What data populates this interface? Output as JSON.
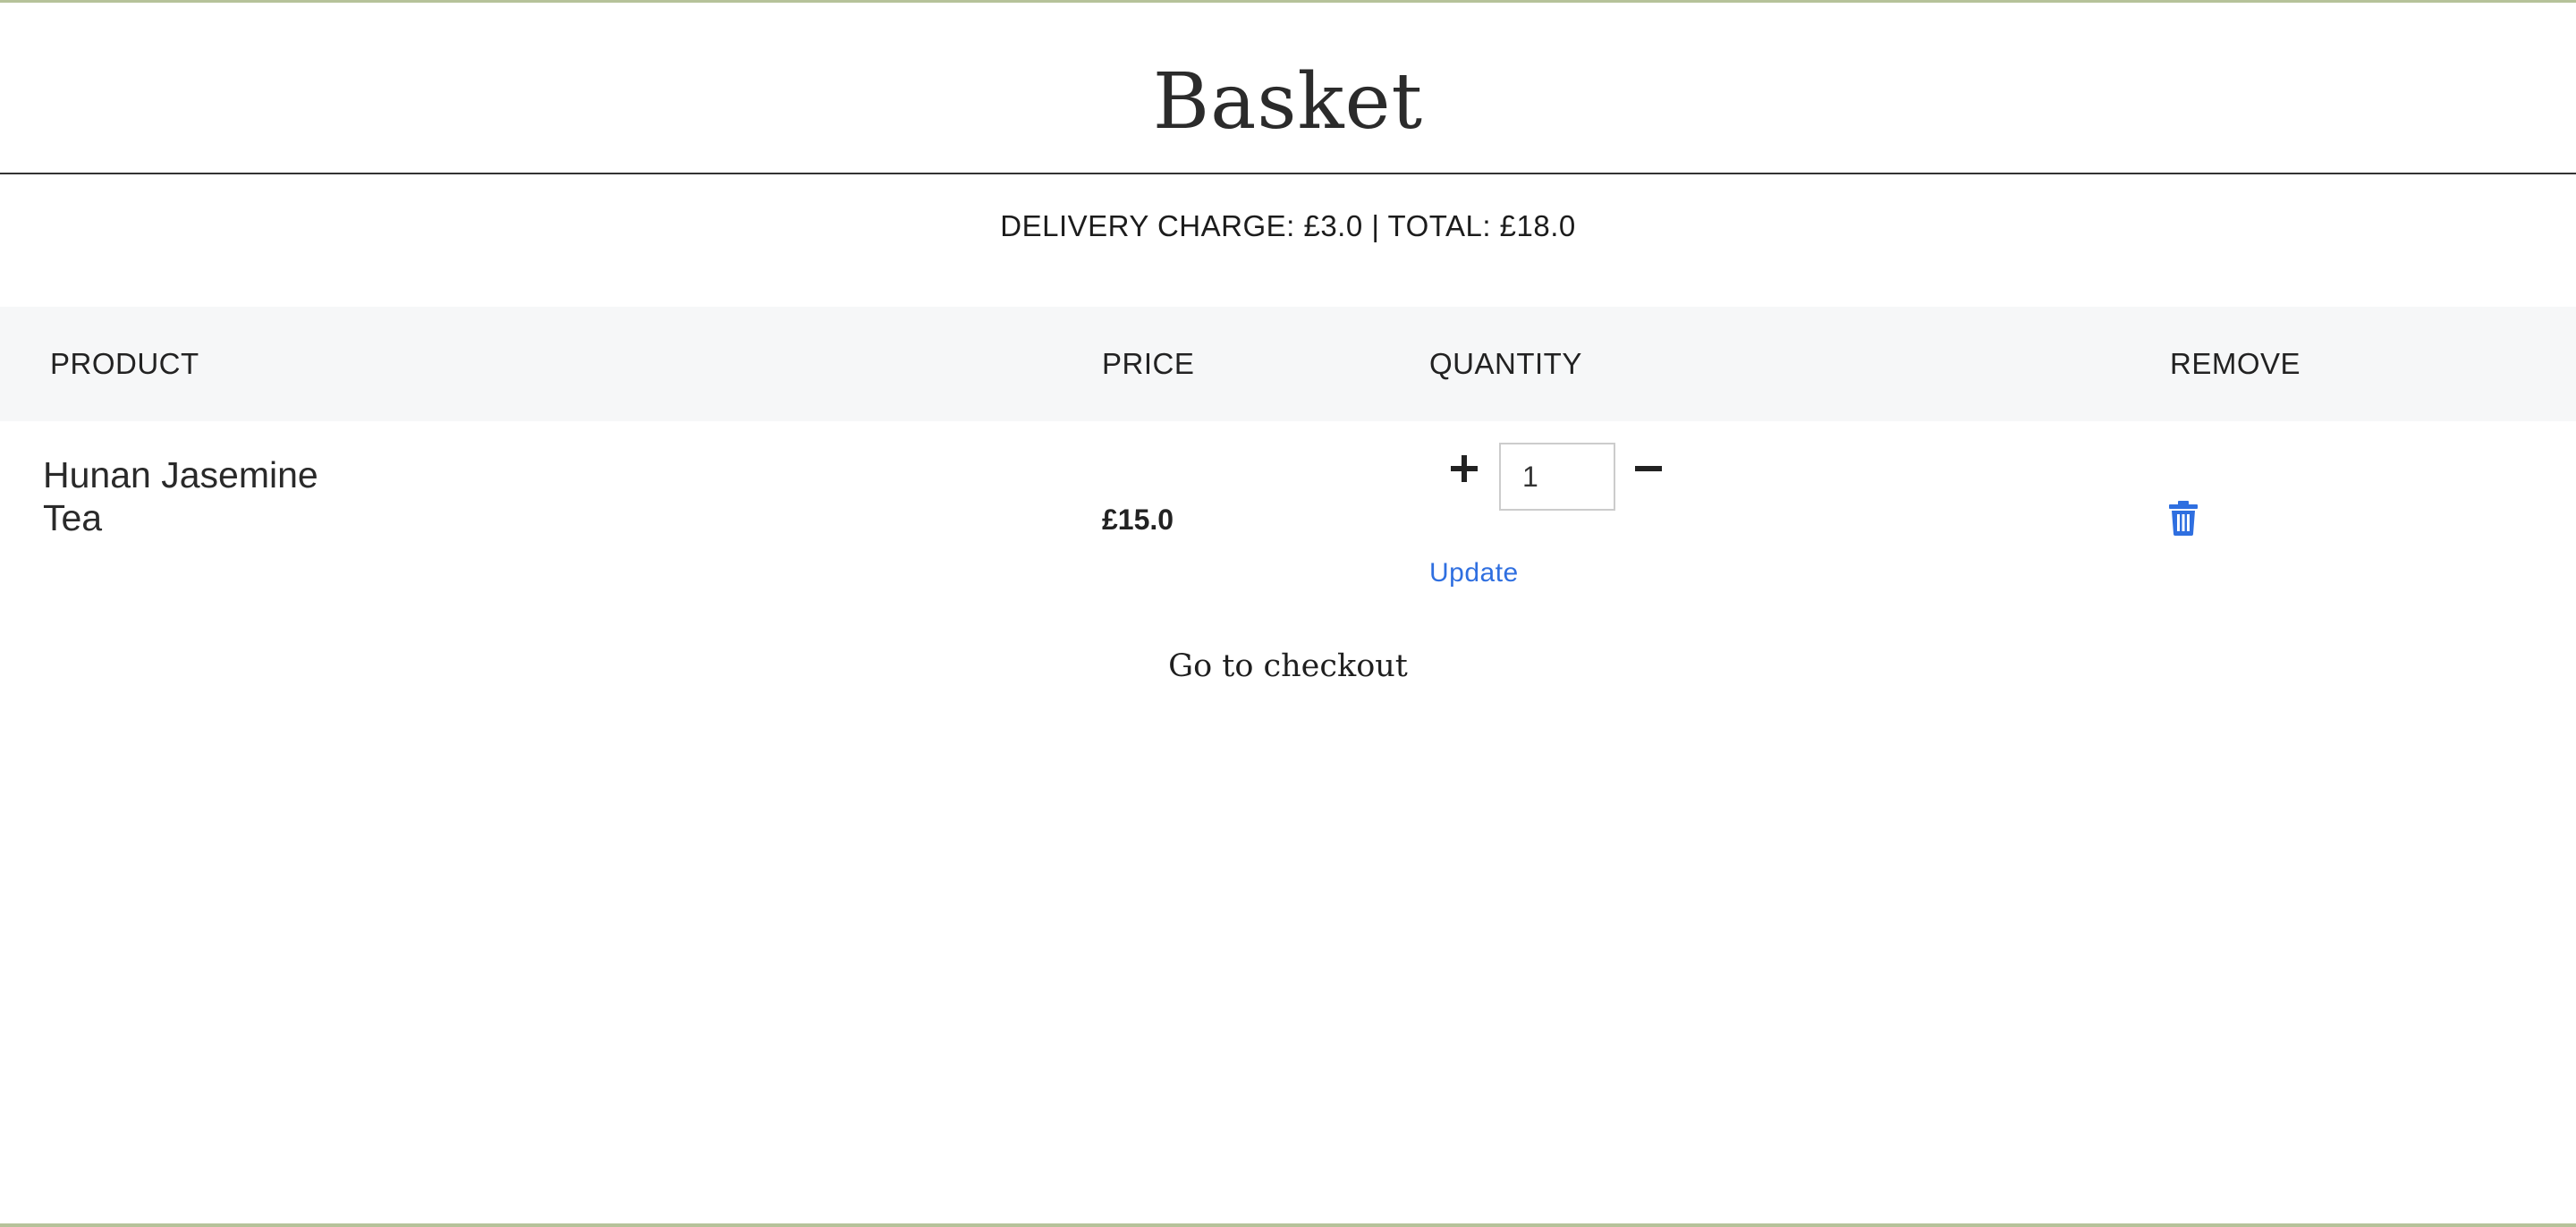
{
  "page": {
    "title": "Basket"
  },
  "summary": {
    "text": "DELIVERY CHARGE: £3.0 | TOTAL: £18.0"
  },
  "table": {
    "headers": {
      "product": "PRODUCT",
      "price": "PRICE",
      "quantity": "QUANTITY",
      "remove": "REMOVE"
    },
    "rows": [
      {
        "product_line1": "Hunan Jasemine",
        "product_line2": "Tea",
        "price": "£15.0",
        "quantity": "1",
        "update_label": "Update",
        "increment_icon": "plus-icon",
        "decrement_icon": "minus-icon",
        "remove_icon": "trash-icon"
      }
    ]
  },
  "checkout": {
    "label": "Go to checkout"
  },
  "colors": {
    "accent_blue": "#2f6fe0",
    "border_green": "#b6c29a",
    "header_bg": "#f6f7f8"
  }
}
